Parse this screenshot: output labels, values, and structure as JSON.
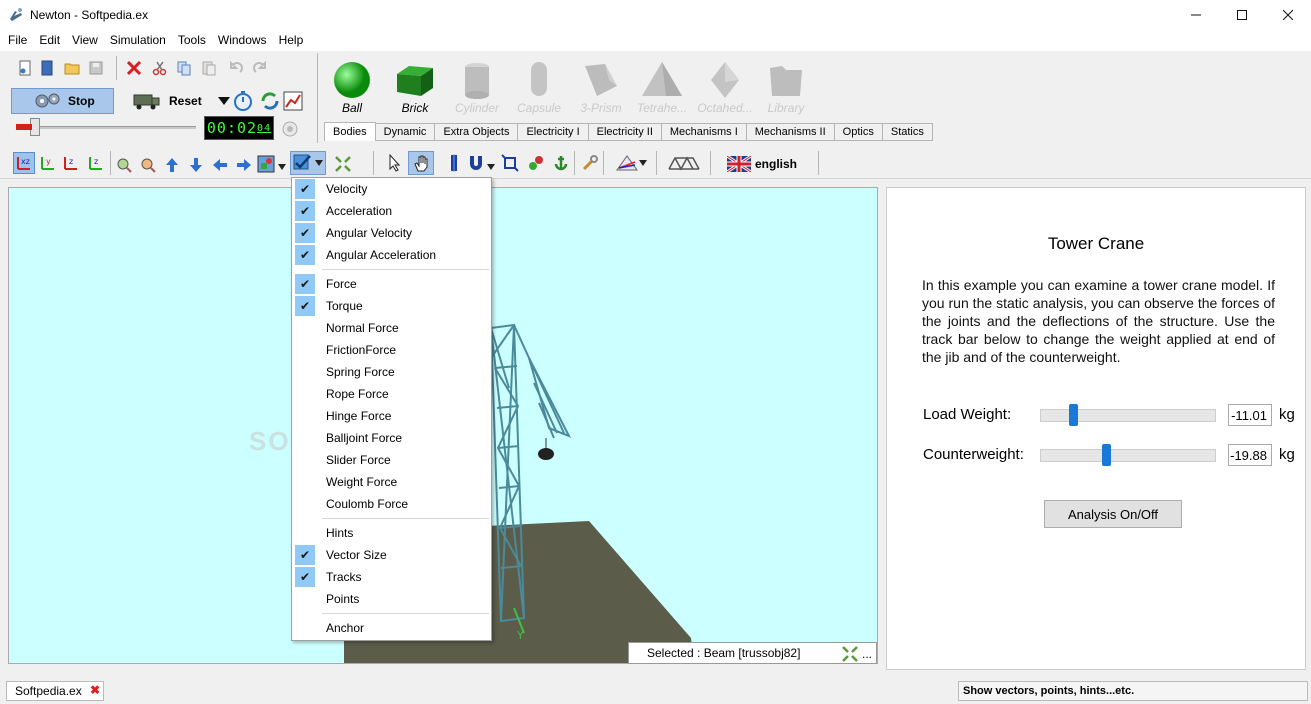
{
  "window": {
    "title": "Newton - Softpedia.ex"
  },
  "menu": [
    "File",
    "Edit",
    "View",
    "Simulation",
    "Tools",
    "Windows",
    "Help"
  ],
  "controls": {
    "stop_label": "Stop",
    "reset_label": "Reset",
    "timer": "00:02",
    "timer_suffix": "04"
  },
  "bodies": [
    {
      "label": "Ball",
      "enabled": true
    },
    {
      "label": "Brick",
      "enabled": true
    },
    {
      "label": "Cylinder",
      "enabled": false
    },
    {
      "label": "Capsule",
      "enabled": false
    },
    {
      "label": "3-Prism",
      "enabled": false
    },
    {
      "label": "Tetrahe...",
      "enabled": false
    },
    {
      "label": "Octahed...",
      "enabled": false
    },
    {
      "label": "Library",
      "enabled": false
    }
  ],
  "tabs": [
    "Bodies",
    "Dynamic",
    "Extra Objects",
    "Electricity I",
    "Electricity II",
    "Mechanisms I",
    "Mechanisms II",
    "Optics",
    "Statics"
  ],
  "active_tab": "Bodies",
  "language": "english",
  "dropdown": {
    "groups": [
      [
        {
          "label": "Velocity",
          "checked": true
        },
        {
          "label": "Acceleration",
          "checked": true
        },
        {
          "label": "Angular Velocity",
          "checked": true
        },
        {
          "label": "Angular Acceleration",
          "checked": true
        }
      ],
      [
        {
          "label": "Force",
          "checked": true
        },
        {
          "label": "Torque",
          "checked": true
        },
        {
          "label": "Normal Force",
          "checked": false
        },
        {
          "label": "FrictionForce",
          "checked": false
        },
        {
          "label": "Spring Force",
          "checked": false
        },
        {
          "label": "Rope Force",
          "checked": false
        },
        {
          "label": "Hinge Force",
          "checked": false
        },
        {
          "label": "Balljoint Force",
          "checked": false
        },
        {
          "label": "Slider Force",
          "checked": false
        },
        {
          "label": "Weight Force",
          "checked": false
        },
        {
          "label": "Coulomb Force",
          "checked": false
        }
      ],
      [
        {
          "label": "Hints",
          "checked": false
        },
        {
          "label": "Vector Size",
          "checked": true
        },
        {
          "label": "Tracks",
          "checked": true
        },
        {
          "label": "Points",
          "checked": false
        }
      ],
      [
        {
          "label": "Anchor",
          "checked": false
        }
      ]
    ]
  },
  "viewport": {
    "watermark": "SOFTPEDIA",
    "axis_label": "Y",
    "selected": "Selected : Beam [trussobj82]",
    "more": "..."
  },
  "panel": {
    "title": "Tower Crane",
    "description": "In this example you can examine a tower crane model. If you run the static analysis, you can observe the forces of the joints and the deflections of the structure. Use the track bar below to change the weight applied at end of the jib and of the counterweight.",
    "load_label": "Load Weight:",
    "load_value": "-11.01",
    "load_fraction": 0.19,
    "counter_label": "Counterweight:",
    "counter_value": "-19.88",
    "counter_fraction": 0.38,
    "unit": "kg",
    "analysis_button": "Analysis On/Off"
  },
  "bottom": {
    "doc_tab": "Softpedia.ex",
    "close": "✖",
    "hint": "Show vectors, points, hints...etc."
  },
  "colors": {
    "stop_bg": "#a9c7ea",
    "sky": "#ccffff",
    "ground": "#5c5c4a",
    "check_bg": "#90c8f6",
    "thumb": "#1a78d6"
  }
}
